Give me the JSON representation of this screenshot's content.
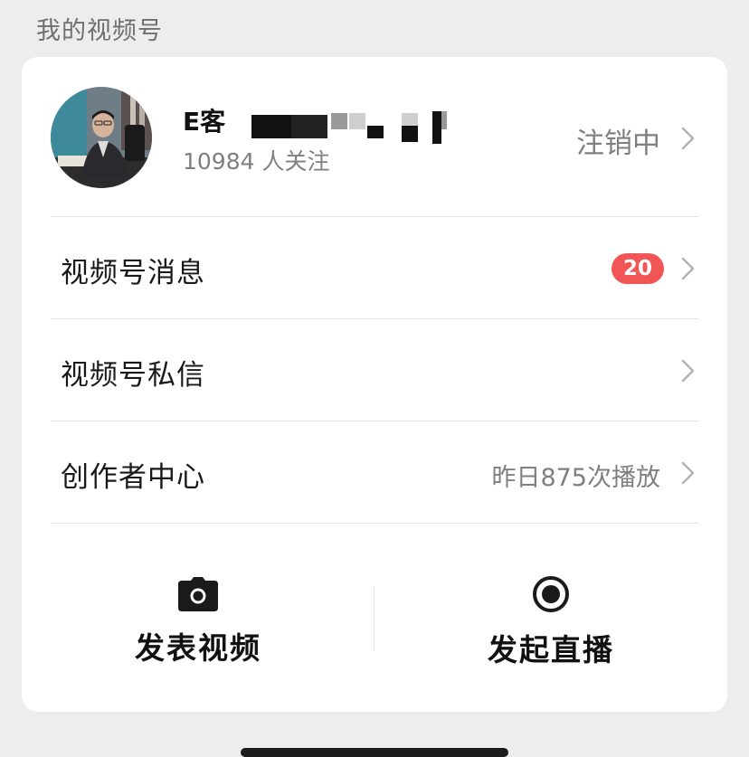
{
  "section_title": "我的视频号",
  "profile": {
    "name": "E客",
    "followers": "10984 人关注",
    "status": "注销中"
  },
  "rows": [
    {
      "label": "视频号消息",
      "badge": "20"
    },
    {
      "label": "视频号私信"
    },
    {
      "label": "创作者中心",
      "extra": "昨日875次播放"
    }
  ],
  "actions": [
    {
      "label": "发表视频",
      "icon": "camera-icon"
    },
    {
      "label": "发起直播",
      "icon": "live-record-icon"
    }
  ],
  "colors": {
    "background": "#ededed",
    "card": "#ffffff",
    "badge": "#f25555",
    "secondary_text": "#7f7f7f"
  }
}
